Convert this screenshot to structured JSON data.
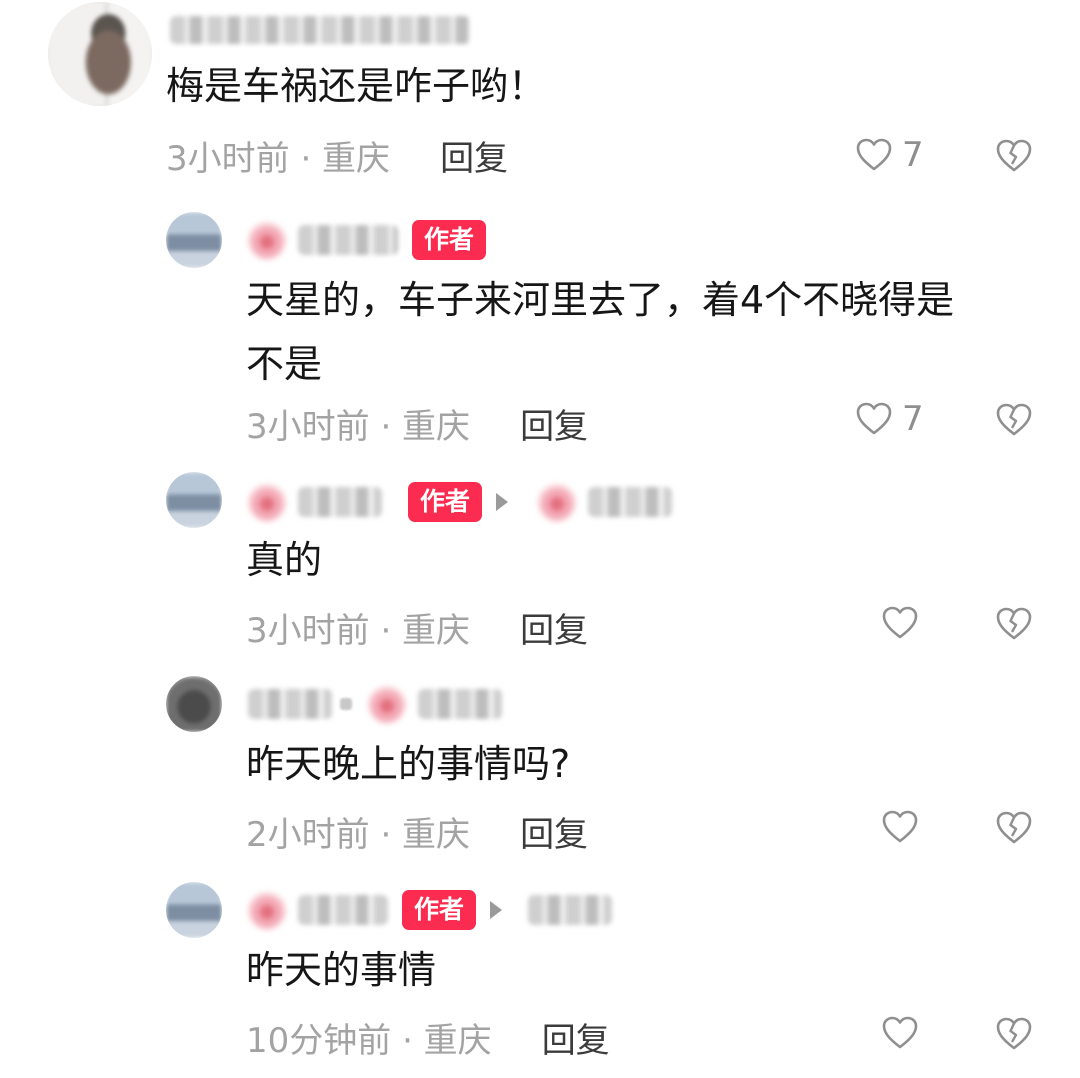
{
  "comments": [
    {
      "text": "梅是车祸还是咋子哟！",
      "time_location": "3小时前 · 重庆",
      "reply_label": "回复",
      "likes": "7"
    },
    {
      "author_badge": "作者",
      "text": "天星的，车子来河里去了，着4个不晓得是\n不是",
      "time_location": "3小时前 · 重庆",
      "reply_label": "回复",
      "likes": "7"
    },
    {
      "author_badge": "作者",
      "text": "真的",
      "time_location": "3小时前 · 重庆",
      "reply_label": "回复",
      "likes": ""
    },
    {
      "text": "昨天晚上的事情吗?",
      "time_location": "2小时前 · 重庆",
      "reply_label": "回复",
      "likes": ""
    },
    {
      "author_badge": "作者",
      "text": "昨天的事情",
      "time_location": "10分钟前 · 重庆",
      "reply_label": "回复",
      "likes": ""
    }
  ],
  "icons": {
    "like": "heart-outline-icon",
    "dislike": "broken-heart-icon",
    "reply_to": "triangle-right-icon"
  },
  "colors": {
    "author_badge_bg": "#fb2c50",
    "meta_text": "#a3a3a3",
    "reply_text": "#3b3b3b",
    "body_text": "#161616"
  }
}
